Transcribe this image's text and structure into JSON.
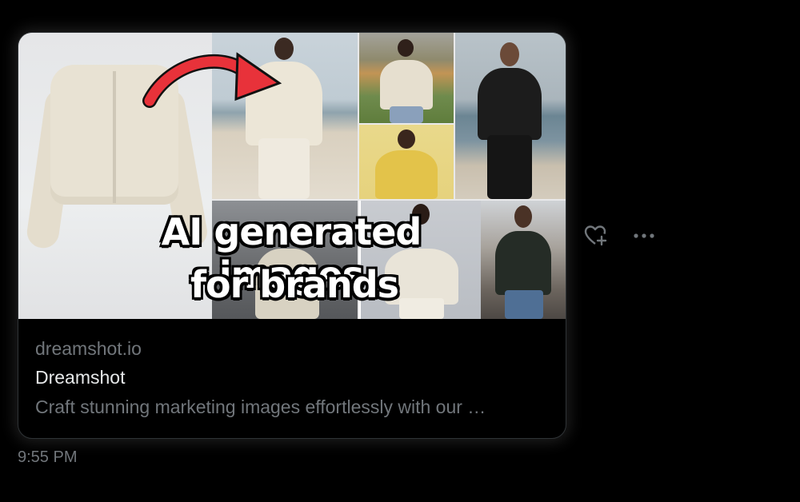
{
  "card": {
    "headline_line1": "AI generated images",
    "headline_line2": "for brands",
    "domain": "dreamshot.io",
    "title": "Dreamshot",
    "description": "Craft stunning marketing images effortlessly with our …"
  },
  "timestamp": "9:55 PM",
  "actions": {
    "like_icon": "heart-plus-icon",
    "more_icon": "ellipsis-icon"
  },
  "colors": {
    "background": "#000000",
    "muted_text": "#71767b",
    "primary_text": "#e7e9ea",
    "arrow": "#e8323a"
  }
}
